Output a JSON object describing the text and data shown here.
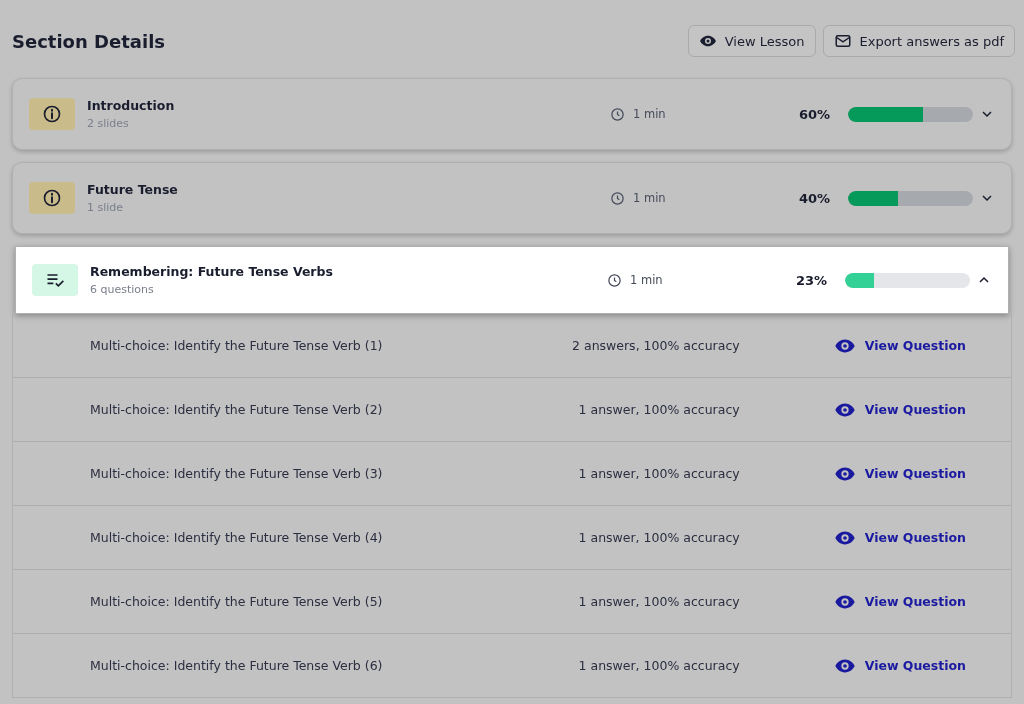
{
  "header": {
    "title": "Section Details",
    "buttons": [
      {
        "kind": "view",
        "label": "View Lesson"
      },
      {
        "kind": "mail",
        "label": "Export answers as pdf"
      }
    ]
  },
  "sections": [
    {
      "kind": "info",
      "title": "Introduction",
      "subtitle": "2 slides",
      "duration": "1 min",
      "percent": "60%",
      "level": 0.6,
      "expanded": false,
      "highlighted": false
    },
    {
      "kind": "info",
      "title": "Future Tense",
      "subtitle": "1 slide",
      "duration": "1 min",
      "percent": "40%",
      "level": 0.4,
      "expanded": false,
      "highlighted": false
    },
    {
      "kind": "quiz",
      "title": "Remembering: Future Tense Verbs",
      "subtitle": "6 questions",
      "duration": "1 min",
      "percent": "23%",
      "level": 0.23,
      "expanded": true,
      "highlighted": true,
      "questions": [
        {
          "title": "Multi-choice: Identify the Future Tense Verb (1)",
          "stats": "2 answers, 100% accuracy",
          "action": "View Question"
        },
        {
          "title": "Multi-choice: Identify the Future Tense Verb (2)",
          "stats": "1 answer, 100% accuracy",
          "action": "View Question"
        },
        {
          "title": "Multi-choice: Identify the Future Tense Verb (3)",
          "stats": "1 answer, 100% accuracy",
          "action": "View Question"
        },
        {
          "title": "Multi-choice: Identify the Future Tense Verb (4)",
          "stats": "1 answer, 100% accuracy",
          "action": "View Question"
        },
        {
          "title": "Multi-choice: Identify the Future Tense Verb (5)",
          "stats": "1 answer, 100% accuracy",
          "action": "View Question"
        },
        {
          "title": "Multi-choice: Identify the Future Tense Verb (6)",
          "stats": "1 answer, 100% accuracy",
          "action": "View Question"
        }
      ]
    }
  ]
}
